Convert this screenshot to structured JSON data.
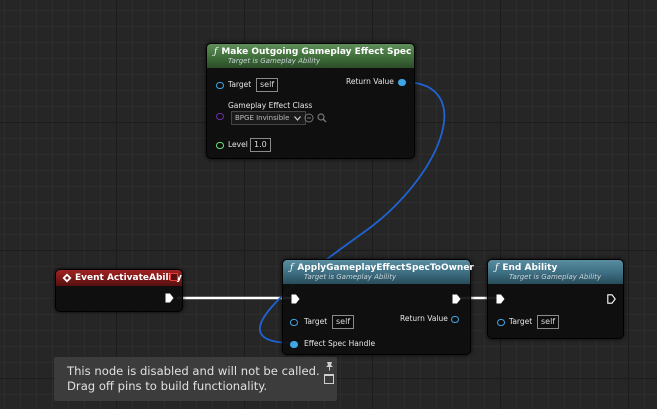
{
  "colors": {
    "function_header": "#3c6d80",
    "event_header": "#7a1818",
    "make_spec_header": "#3f6e3a",
    "wire_blue": "#1f63d4",
    "pin_blue": "#3fa6e6",
    "pin_purple": "#6b2fa8",
    "pin_green": "#6de07a"
  },
  "make_spec_node": {
    "title": "Make Outgoing Gameplay Effect Spec",
    "subtitle": "Target is Gameplay Ability",
    "target_label": "Target",
    "target_value": "self",
    "return_label": "Return Value",
    "class_label": "Gameplay Effect Class",
    "class_value": "BPGE Invinsible",
    "level_label": "Level",
    "level_value": "1.0"
  },
  "event_node": {
    "title": "Event ActivateAbility"
  },
  "apply_node": {
    "title": "ApplyGameplayEffectSpecToOwner",
    "subtitle": "Target is Gameplay Ability",
    "target_label": "Target",
    "target_value": "self",
    "return_label": "Return Value",
    "spec_label": "Effect Spec Handle"
  },
  "end_node": {
    "title": "End Ability",
    "subtitle": "Target is Gameplay Ability",
    "target_label": "Target",
    "target_value": "self"
  },
  "tooltip": {
    "line1": "This node is disabled and will not be called.",
    "line2": "Drag off pins to build functionality."
  },
  "icons": {
    "function": "function-icon",
    "event": "event-diamond-icon",
    "delegate": "delegate-square-icon",
    "exec": "exec-pin-icon",
    "search": "search-icon",
    "clear": "clear-icon",
    "dropdown": "chevron-down-icon",
    "pin": "pin-icon"
  }
}
